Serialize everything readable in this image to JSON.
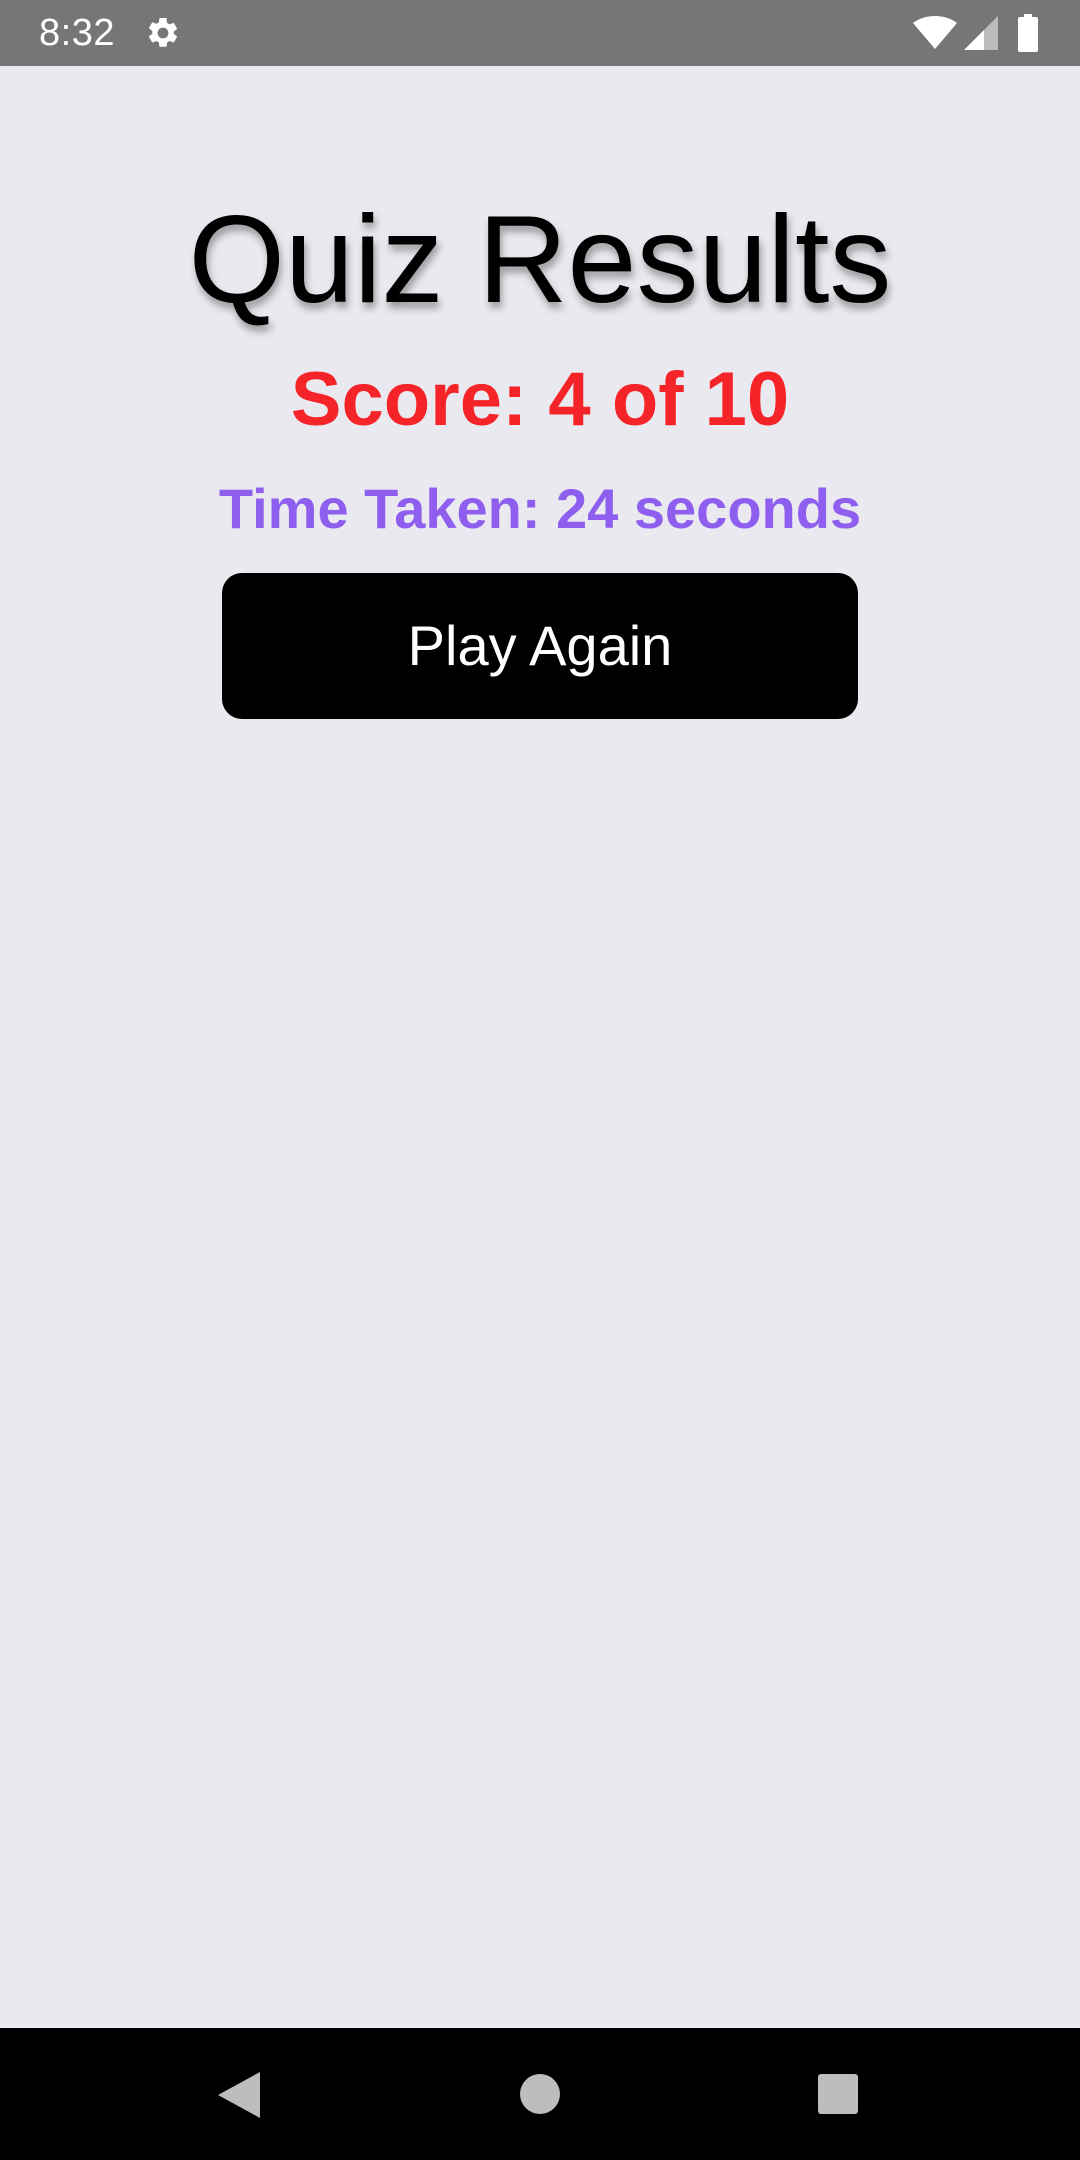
{
  "status_bar": {
    "time": "8:32",
    "icons": [
      "gear-icon",
      "wifi-icon",
      "cellular-signal-icon",
      "battery-icon"
    ],
    "background": "#767676"
  },
  "results": {
    "title": "Quiz Results",
    "score_text": "Score: 4 of 10",
    "time_taken_text": "Time Taken: 24 seconds",
    "play_again_label": "Play Again"
  },
  "colors": {
    "background": "#EAE9EF",
    "score": "#F52428",
    "time_taken": "#8E5EEE",
    "button": "#000000",
    "button_text": "#FFFFFF"
  },
  "nav_bar": {
    "icons": [
      "back-icon",
      "home-icon",
      "recents-icon"
    ]
  }
}
